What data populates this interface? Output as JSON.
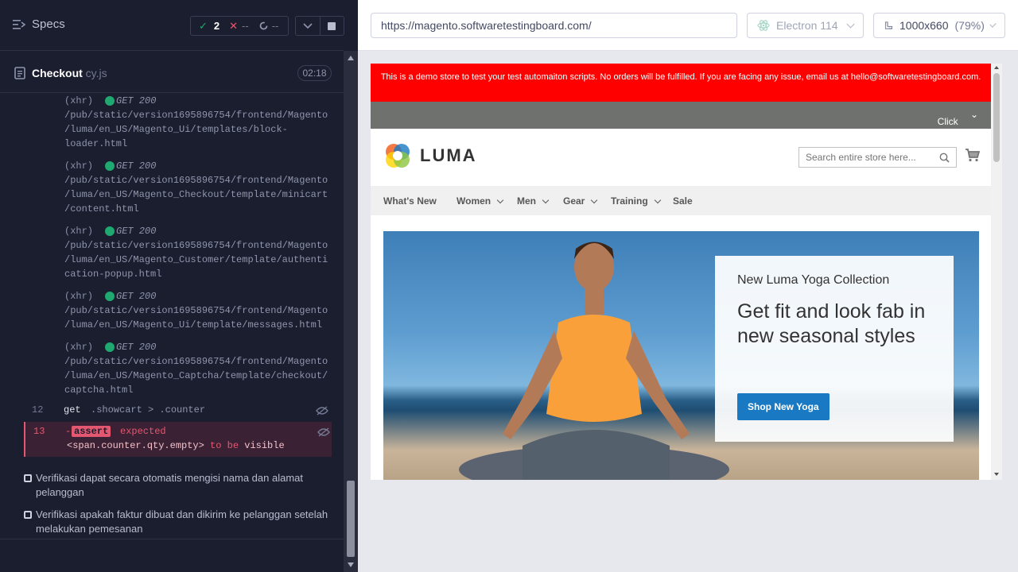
{
  "reporter": {
    "specs_label": "Specs",
    "stats": {
      "passed": "2",
      "failed": "--",
      "pending": "--"
    },
    "spec_name": "Checkout",
    "spec_ext": " cy.js",
    "duration": "02:18",
    "xhr_logs": [
      {
        "tag": "(xhr)",
        "method": "GET 200",
        "url": "/pub/static/version1695896754/frontend/Magento\n/luma/en_US/Magento_Ui/templates/block-\nloader.html"
      },
      {
        "tag": "(xhr)",
        "method": "GET 200",
        "url": "/pub/static/version1695896754/frontend/Magento\n/luma/en_US/Magento_Checkout/template/minicart\n/content.html"
      },
      {
        "tag": "(xhr)",
        "method": "GET 200",
        "url": "/pub/static/version1695896754/frontend/Magento\n/luma/en_US/Magento_Customer/template/authenti\ncation-popup.html"
      },
      {
        "tag": "(xhr)",
        "method": "GET 200",
        "url": "/pub/static/version1695896754/frontend/Magento\n/luma/en_US/Magento_Ui/template/messages.html"
      },
      {
        "tag": "(xhr)",
        "method": "GET 200",
        "url": "/pub/static/version1695896754/frontend/Magento\n/luma/en_US/Magento_Captcha/template/checkout/\ncaptcha.html"
      }
    ],
    "cmd_get": {
      "num": "12",
      "name": "get",
      "msg": ".showcart > .counter"
    },
    "cmd_assert": {
      "num": "13",
      "dash": "-",
      "name": "assert",
      "kw": "expected",
      "selector": "<span.counter.qty.empty>",
      "to_be": "to be",
      "state": "visible"
    },
    "tests": [
      "Verifikasi dapat secara otomatis mengisi nama dan alamat pelanggan",
      "Verifikasi apakah faktur dibuat dan dikirim ke pelanggan setelah melakukan pemesanan"
    ]
  },
  "aut": {
    "url": "https://magento.softwaretestingboard.com/",
    "browser": "Electron 114",
    "viewport": "1000x660",
    "scale": "(79%)"
  },
  "store": {
    "demo_banner": "This is a demo store to test your test automaiton scripts. No orders will be fulfilled. If you are facing any issue, email us at hello@softwaretestingboard.com.",
    "promo": "Click “Write for us” link in the footer to submit a guest post",
    "logo": "LUMA",
    "search_placeholder": "Search entire store here...",
    "nav": [
      "What's New",
      "Women",
      "Men",
      "Gear",
      "Training",
      "Sale"
    ],
    "hero": {
      "eyebrow": "New Luma Yoga Collection",
      "title": "Get fit and look fab in new seasonal styles",
      "button": "Shop New Yoga"
    }
  },
  "colors": {
    "pass": "#1fa971",
    "fail": "#e45770",
    "reporter_bg": "#1b1e2e",
    "banner_red": "#ff0000",
    "luma_blue": "#1979c3"
  }
}
